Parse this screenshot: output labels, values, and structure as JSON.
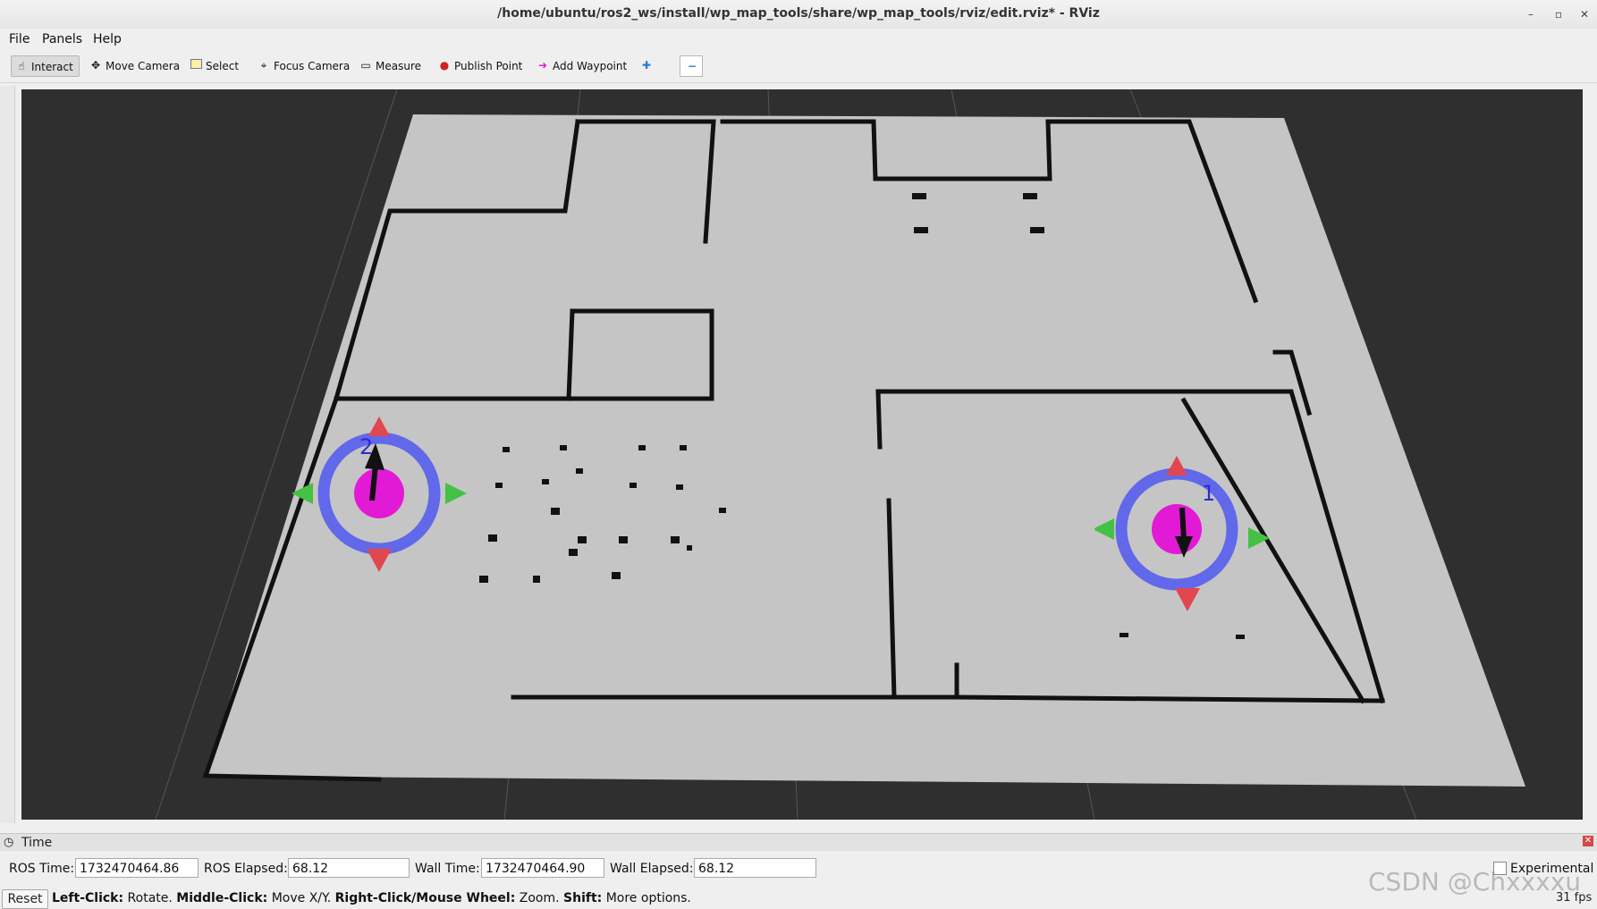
{
  "window": {
    "title": "/home/ubuntu/ros2_ws/install/wp_map_tools/share/wp_map_tools/rviz/edit.rviz* - RViz"
  },
  "menu": [
    "File",
    "Panels",
    "Help"
  ],
  "toolbar": {
    "tools": [
      {
        "label": "Interact",
        "icon": "hand-pointer-icon"
      },
      {
        "label": "Move Camera",
        "icon": "move-camera-icon"
      },
      {
        "label": "Select",
        "icon": "select-icon"
      },
      {
        "label": "Focus Camera",
        "icon": "focus-camera-icon"
      },
      {
        "label": "Measure",
        "icon": "ruler-icon"
      },
      {
        "label": "Publish Point",
        "icon": "map-pin-icon"
      },
      {
        "label": "Add Waypoint",
        "icon": "waypoint-icon"
      }
    ],
    "active": "Interact"
  },
  "viewport": {
    "waypoints": [
      {
        "label": "1"
      },
      {
        "label": "2"
      }
    ]
  },
  "time_panel": {
    "title": "Time",
    "ros_time_label": "ROS Time:",
    "ros_time": "1732470464.86",
    "ros_elapsed_label": "ROS Elapsed:",
    "ros_elapsed": "68.12",
    "wall_time_label": "Wall Time:",
    "wall_time": "1732470464.90",
    "wall_elapsed_label": "Wall Elapsed:",
    "wall_elapsed": "68.12",
    "experimental_label": "Experimental"
  },
  "status": {
    "reset_label": "Reset",
    "hint_1b": "Left-Click:",
    "hint_1": " Rotate. ",
    "hint_2b": "Middle-Click:",
    "hint_2": " Move X/Y. ",
    "hint_3b": "Right-Click/Mouse Wheel:",
    "hint_3": " Zoom. ",
    "hint_4b": "Shift:",
    "hint_4": " More options.",
    "fps": "31 fps"
  },
  "watermark": "CSDN @Chxxxxu"
}
